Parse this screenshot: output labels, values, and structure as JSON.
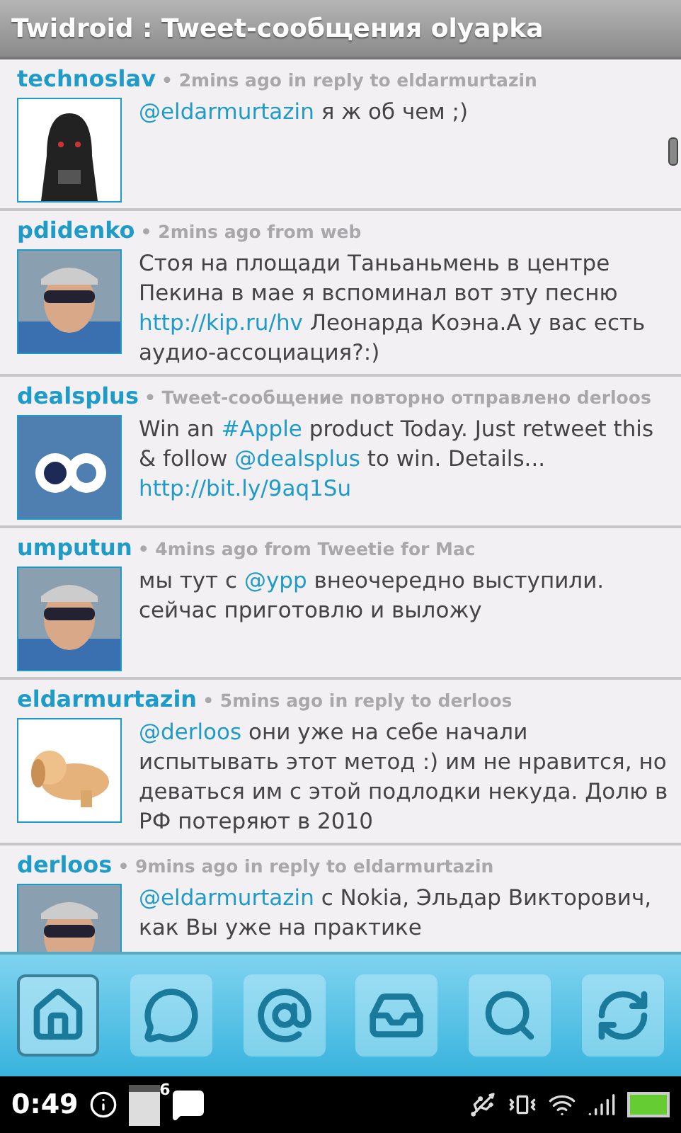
{
  "title_bar": {
    "title": "Twidroid : Tweet-сообщения olyapka"
  },
  "tweets": [
    {
      "user": "technoslav",
      "meta": "• 2mins ago in reply to eldarmurtazin",
      "body": [
        {
          "kind": "link",
          "text": "@eldarmurtazin"
        },
        {
          "kind": "text",
          "text": " я ж об чем ;)"
        }
      ]
    },
    {
      "user": "pdidenko",
      "meta": "• 2mins ago from web",
      "body": [
        {
          "kind": "text",
          "text": "Стоя на площади Таньаньмень в центре Пекина в мае я вспоминал вот эту песню "
        },
        {
          "kind": "link",
          "text": "http://kip.ru/hv"
        },
        {
          "kind": "text",
          "text": " Леонарда Коэна.А у вас есть аудио-ассоциация?:)"
        }
      ]
    },
    {
      "user": "dealsplus",
      "meta": "• Tweet-сообщение повторно отправлено derloos",
      "body": [
        {
          "kind": "text",
          "text": "Win an "
        },
        {
          "kind": "link",
          "text": "#Apple"
        },
        {
          "kind": "text",
          "text": " product Today. Just retweet this & follow "
        },
        {
          "kind": "link",
          "text": "@dealsplus"
        },
        {
          "kind": "text",
          "text": " to win. Details... "
        },
        {
          "kind": "link",
          "text": "http://bit.ly/9aq1Su"
        }
      ]
    },
    {
      "user": "umputun",
      "meta": "• 4mins ago from Tweetie for Mac",
      "body": [
        {
          "kind": "text",
          "text": "мы тут с "
        },
        {
          "kind": "link",
          "text": "@ypp"
        },
        {
          "kind": "text",
          "text": " внеочередно выступили. сейчас приготовлю и выложу"
        }
      ]
    },
    {
      "user": "eldarmurtazin",
      "meta": "• 5mins ago in reply to derloos",
      "body": [
        {
          "kind": "link",
          "text": "@derloos"
        },
        {
          "kind": "text",
          "text": " они уже на себе начали испытывать этот метод :) им не нравится, но деваться им с этой подлодки некуда. Долю в РФ потеряют в 2010"
        }
      ]
    },
    {
      "user": "derloos",
      "meta": "• 9mins ago in reply to eldarmurtazin",
      "body": [
        {
          "kind": "link",
          "text": "@eldarmurtazin"
        },
        {
          "kind": "text",
          "text": " с Nokia, Эльдар Викторович, как Вы уже на практике"
        }
      ]
    }
  ],
  "toolbar": [
    {
      "kind": "home",
      "selected": true
    },
    {
      "kind": "messages",
      "selected": false
    },
    {
      "kind": "mentions",
      "selected": false
    },
    {
      "kind": "inbox",
      "selected": false
    },
    {
      "kind": "search",
      "selected": false
    },
    {
      "kind": "refresh",
      "selected": false
    }
  ],
  "status_bar": {
    "time": "0:49",
    "calendar_day": "6"
  }
}
